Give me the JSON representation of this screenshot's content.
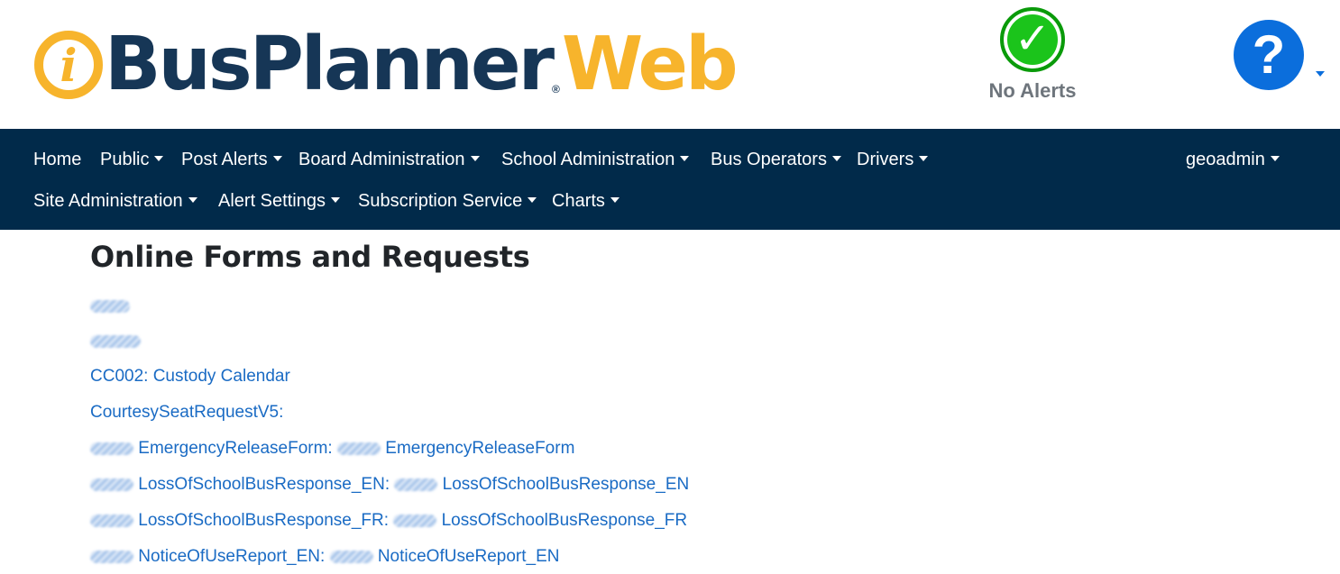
{
  "header": {
    "logo": {
      "part1": "Bus",
      "part2": "Planner",
      "part3": "Web",
      "reg": "®"
    },
    "alert": {
      "label": "No Alerts",
      "icon": "check-circle-icon",
      "color": "#1bc41b"
    },
    "help": {
      "icon": "question-circle-icon",
      "color": "#0b6edc"
    }
  },
  "nav": {
    "row1": [
      "Home",
      "Public",
      "Post Alerts",
      "Board Administration",
      "School Administration",
      "Bus Operators",
      "Drivers"
    ],
    "row2": [
      "Site Administration",
      "Alert Settings",
      "Subscription Service",
      "Charts"
    ],
    "user": "geoadmin",
    "background": "#012a4a"
  },
  "main": {
    "title": "Online Forms and Requests",
    "links": [
      {
        "text": "CC002: Custody Calendar"
      },
      {
        "text": "CourtesySeatRequestV5:"
      },
      {
        "a": "EmergencyReleaseForm:",
        "b": "EmergencyReleaseForm"
      },
      {
        "a": "LossOfSchoolBusResponse_EN:",
        "b": "LossOfSchoolBusResponse_EN"
      },
      {
        "a": "LossOfSchoolBusResponse_FR:",
        "b": "LossOfSchoolBusResponse_FR"
      },
      {
        "a": "NoticeOfUseReport_EN:",
        "b": "NoticeOfUseReport_EN"
      }
    ],
    "link_color": "#1a6bc4"
  }
}
